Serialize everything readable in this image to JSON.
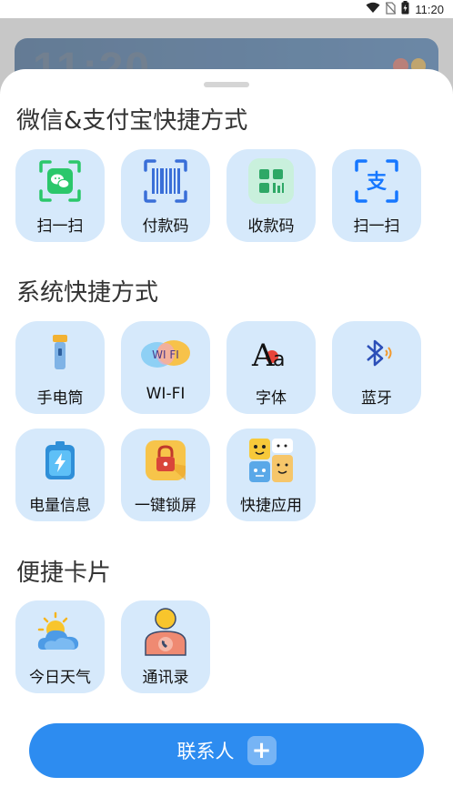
{
  "status_bar": {
    "time": "11:20",
    "icons": [
      "wifi-icon",
      "sim-off-icon",
      "battery-icon"
    ]
  },
  "background": {
    "clock": "11:20"
  },
  "sections": [
    {
      "title": "微信&支付宝快捷方式",
      "items": [
        {
          "label": "扫一扫",
          "icon": "wechat-scan-icon"
        },
        {
          "label": "付款码",
          "icon": "payment-code-icon"
        },
        {
          "label": "收款码",
          "icon": "receive-code-icon"
        },
        {
          "label": "扫一扫",
          "icon": "alipay-scan-icon"
        }
      ]
    },
    {
      "title": "系统快捷方式",
      "items": [
        {
          "label": "手电筒",
          "icon": "flashlight-icon"
        },
        {
          "label": "WI-FI",
          "icon": "wifi-icon"
        },
        {
          "label": "字体",
          "icon": "font-icon"
        },
        {
          "label": "蓝牙",
          "icon": "bluetooth-icon"
        },
        {
          "label": "电量信息",
          "icon": "battery-info-icon"
        },
        {
          "label": "一键锁屏",
          "icon": "lock-screen-icon"
        },
        {
          "label": "快捷应用",
          "icon": "quick-apps-icon"
        }
      ]
    },
    {
      "title": "便捷卡片",
      "items": [
        {
          "label": "今日天气",
          "icon": "weather-icon"
        },
        {
          "label": "通讯录",
          "icon": "contacts-icon"
        }
      ]
    }
  ],
  "icon_glyphs": {
    "font_a": "A",
    "font_a_small": "a",
    "wifi_text": "WI FI",
    "alipay_glyph": "支"
  },
  "cta": {
    "label": "联系人",
    "plus": "+"
  },
  "colors": {
    "tile_bg": "#d6e9fb",
    "accent": "#2d8cf0",
    "wechat_green": "#2bc76b"
  }
}
